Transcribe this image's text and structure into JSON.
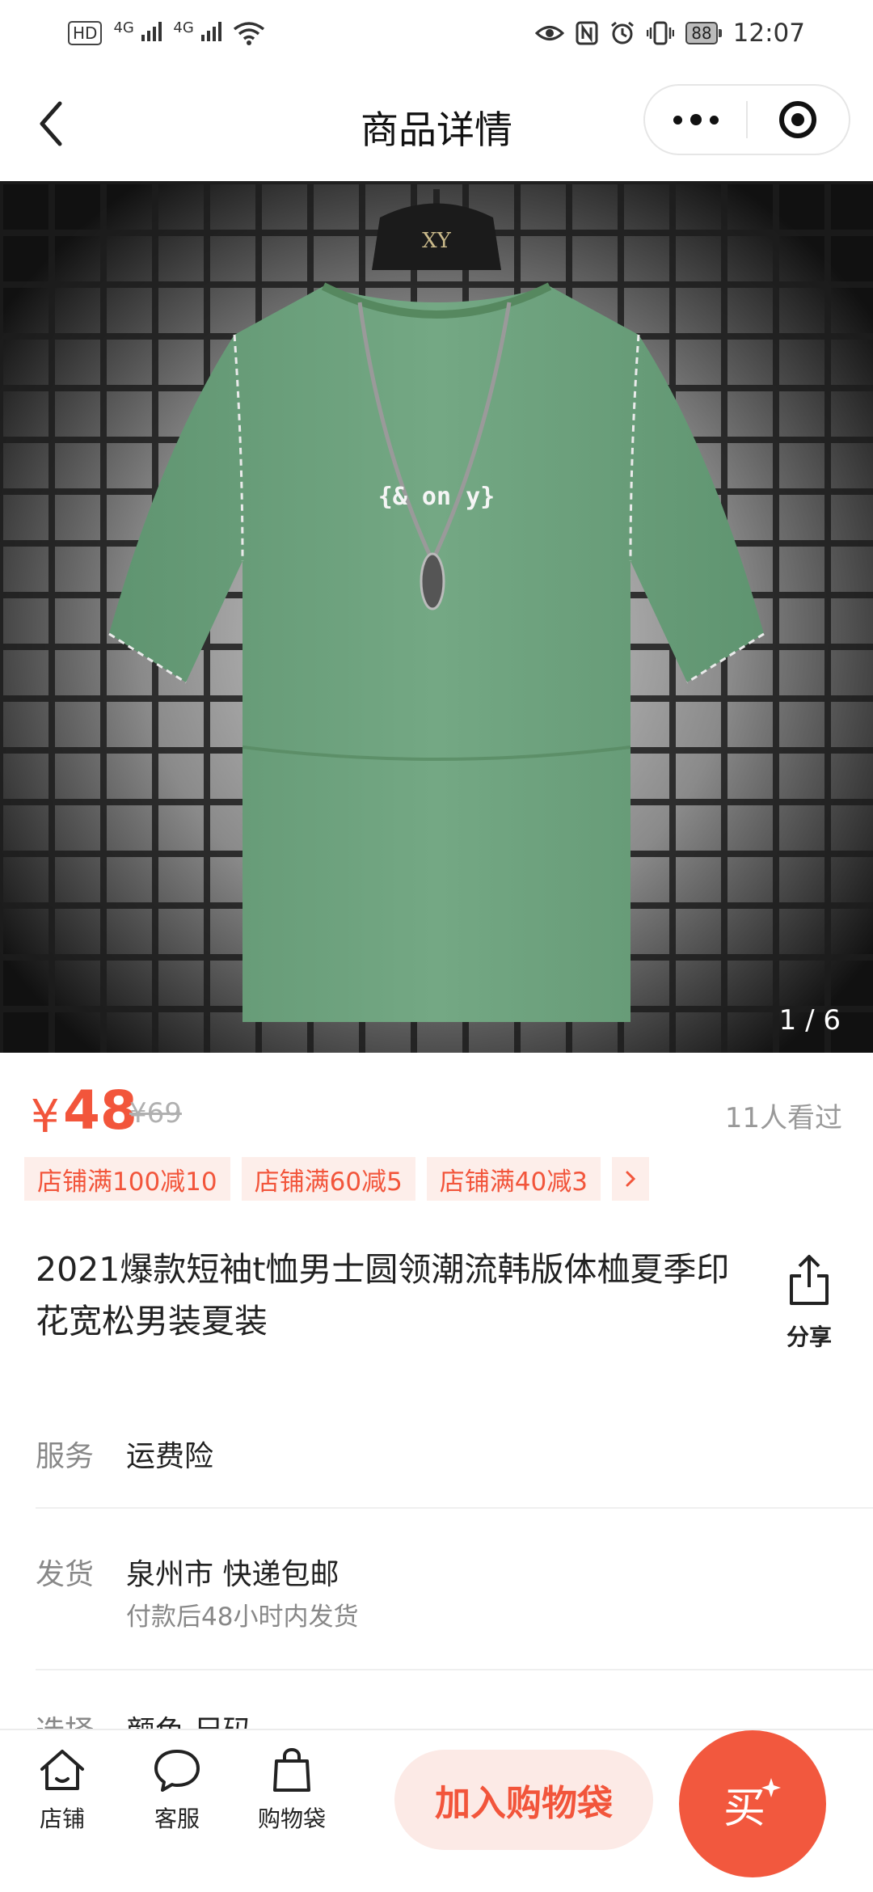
{
  "status_bar": {
    "left_chip": "HD",
    "net1": "4G",
    "net2": "4G",
    "battery": "88",
    "time": "12:07"
  },
  "nav": {
    "title": "商品详情"
  },
  "gallery": {
    "counter": "1 / 6",
    "hanger_text": "XY",
    "shirt_print": "{& on y}",
    "shirt_color": "#6fa37f"
  },
  "price": {
    "currency": "¥",
    "value": "48",
    "original": "¥69",
    "views": "11人看过"
  },
  "coupons": [
    "店铺满100减10",
    "店铺满60减5",
    "店铺满40减3"
  ],
  "coupon_more": "›",
  "product": {
    "title": "2021爆款短袖t恤男士圆领潮流韩版体桖夏季印花宽松男装夏装",
    "share_label": "分享"
  },
  "info": {
    "service_label": "服务",
    "service_value": "运费险",
    "shipping_label": "发货",
    "shipping_value": "泉州市 快递包邮",
    "shipping_sub": "付款后48小时内发货",
    "select_label": "选择",
    "select_value": "颜色 尺码"
  },
  "bottom": {
    "store_label": "店铺",
    "service_label": "客服",
    "bag_label": "购物袋",
    "add_cart": "加入购物袋",
    "buy": "买"
  },
  "colors": {
    "accent": "#f2553b",
    "accent_light": "#fdeeea"
  }
}
